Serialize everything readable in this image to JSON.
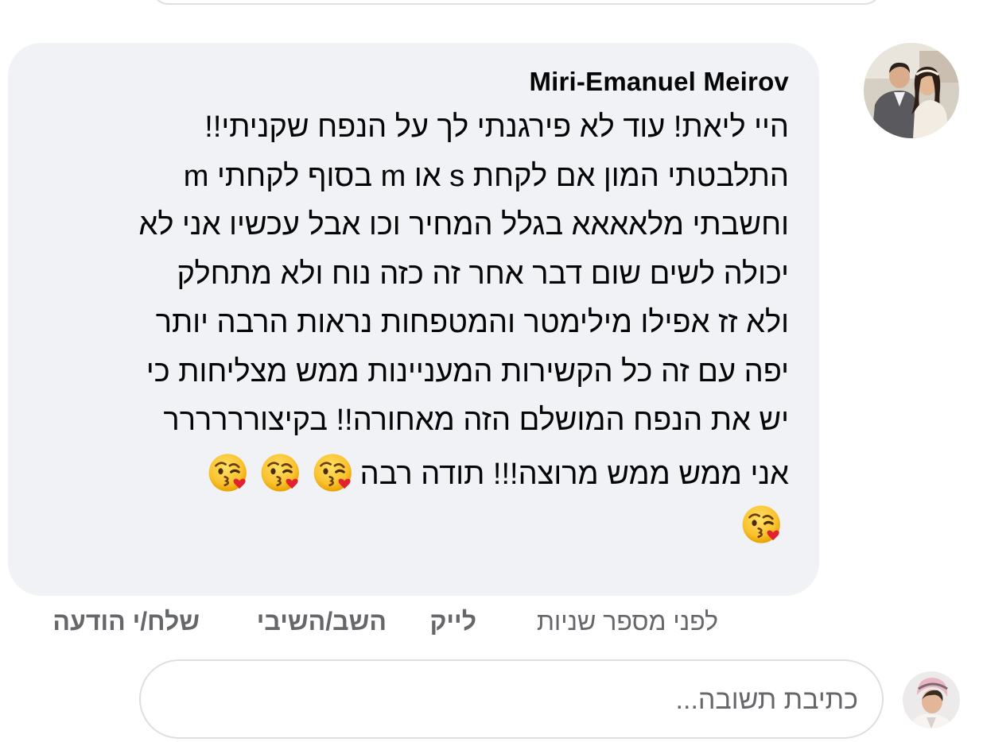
{
  "comment": {
    "author": "Miri-Emanuel Meirov",
    "lines": [
      "היי ליאת! עוד לא פירגנתי לך על הנפח שקניתי!!",
      "התלבטתי המון אם לקחת s או m בסוף לקחתי m",
      "וחשבתי מלאאאא בגלל המחיר וכו אבל עכשיו אני לא",
      "יכולה לשים שום דבר אחר זה כזה נוח ולא מתחלק",
      "ולא זז אפילו מילימטר והמטפחות נראות הרבה יותר",
      "יפה עם זה כל הקשירות המעניינות ממש מצליחות כי",
      "יש את הנפח המושלם הזה מאחורה!! בקיצורררררר",
      "אני ממש ממש מרוצה!!! תודה רבה"
    ],
    "emojis": [
      "face-blowing-a-kiss",
      "face-blowing-a-kiss",
      "face-blowing-a-kiss",
      "face-blowing-a-kiss"
    ]
  },
  "actions": {
    "timestamp": "לפני מספר שניות",
    "like": "לייק",
    "reply": "השב/השיבי",
    "send_message": "שלח/י הודעה"
  },
  "reply_box": {
    "placeholder": "כתיבת תשובה..."
  },
  "colors": {
    "bubble_bg": "#f0f2f5",
    "text": "#050505",
    "secondary_text": "#65676b",
    "border": "#dddfe3"
  }
}
